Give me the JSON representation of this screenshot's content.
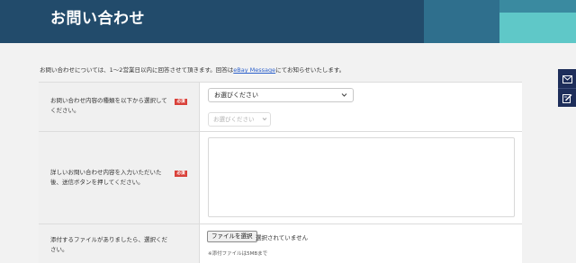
{
  "header": {
    "title": "お問い合わせ"
  },
  "intro": {
    "text_before": "お問い合わせについては、1〜2営業日以内に回答させて頂きます。回答は",
    "link_text": "eBay Message",
    "text_after": "にてお知らせいたします。"
  },
  "form": {
    "required_badge": "必須",
    "inquiry_type": {
      "label": "お問い合わせ内容の種類を以下から選択してください。",
      "select1_value": "お選びください",
      "select2_placeholder": "お選びください"
    },
    "details": {
      "label": "詳しいお問い合わせ内容を入力いただいた後、送信ボタンを押してください。"
    },
    "attachment": {
      "label": "添付するファイルがありましたら、選択ください。",
      "button_label": "ファイルを選択",
      "status": "選択されていません",
      "note": "※添付ファイルは5MBまで"
    }
  },
  "side_tabs": {
    "icon1": "mail-icon",
    "icon2": "edit-form-icon"
  },
  "colors": {
    "header_bg": "#224b6b",
    "header_accent_teal": "#5fc8c8",
    "required_badge": "#d9413a",
    "side_tab_bg": "#1e2e5a",
    "link": "#2a5fcb"
  }
}
